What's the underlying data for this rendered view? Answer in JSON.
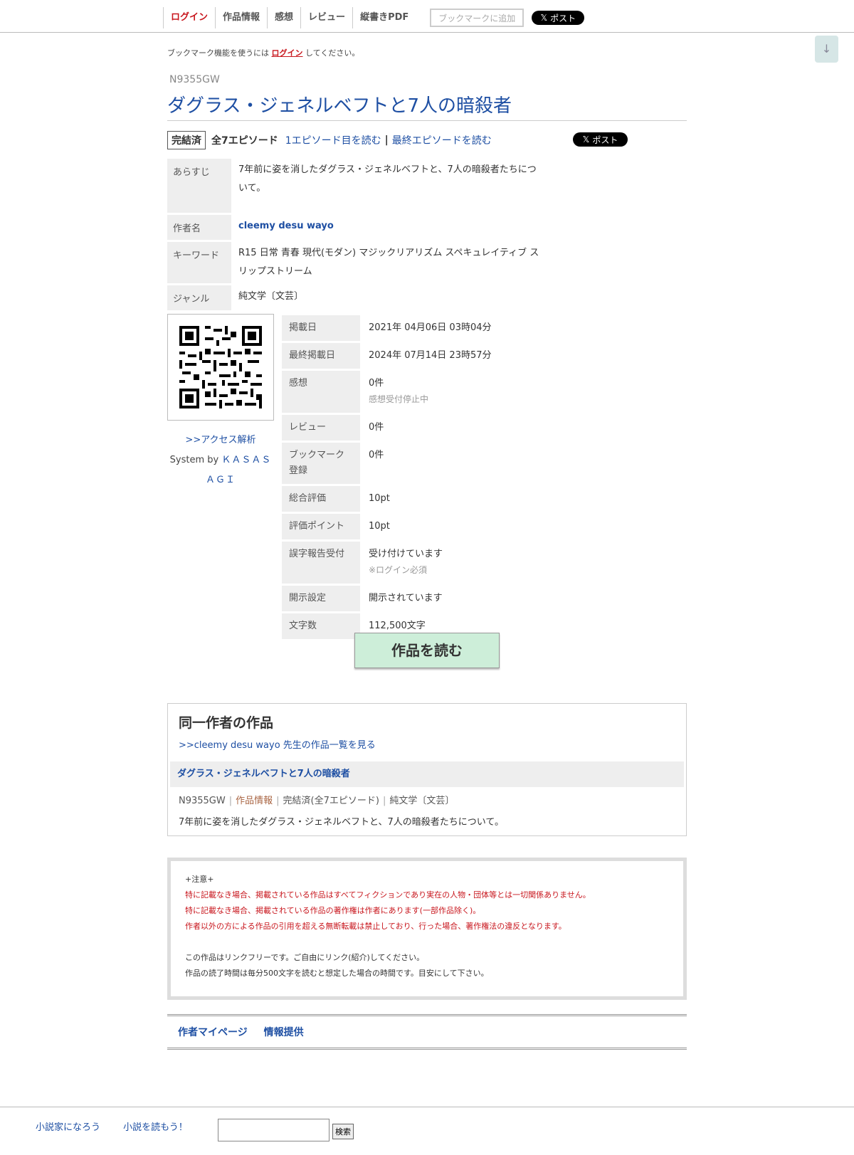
{
  "topnav": {
    "login": "ログイン",
    "novel_info": "作品情報",
    "impressions": "感想",
    "review": "レビュー",
    "pdf": "縦書きPDF",
    "bookmark_add": "ブックマークに追加",
    "x_post": "ポスト"
  },
  "bookmark_note": {
    "prefix": "ブックマーク機能を使うには",
    "login": "ログイン",
    "suffix": "してください。"
  },
  "novel": {
    "ncode": "N9355GW",
    "title": "ダグラス・ジェネルベフトと7人の暗殺者",
    "status": "完結済",
    "episodes": "全7エピソード",
    "read_first": "1エピソード目を読む",
    "separator": "|",
    "read_last": "最終エピソードを読む"
  },
  "info1": [
    {
      "label": "あらすじ",
      "value": "7年前に姿を消したダグラス・ジェネルベフトと、7人の暗殺者たちについて。"
    },
    {
      "label": "作者名",
      "value": "cleemy desu wayo"
    },
    {
      "label": "キーワード",
      "value": "R15 日常 青春 現代(モダン) マジックリアリズム スペキュレイティブ スリップストリーム"
    },
    {
      "label": "ジャンル",
      "value": "純文学〔文芸〕"
    }
  ],
  "access": {
    "link": ">>アクセス解析",
    "system_by": "System by",
    "system_name": "ＫＡＳＡＳＡＧＩ"
  },
  "info2": [
    {
      "label": "掲載日",
      "value": "2021年 04月06日 03時04分",
      "sub": ""
    },
    {
      "label": "最終掲載日",
      "value": "2024年 07月14日 23時57分",
      "sub": ""
    },
    {
      "label": "感想",
      "value": "0件",
      "sub": "感想受付停止中"
    },
    {
      "label": "レビュー",
      "value": "0件",
      "sub": ""
    },
    {
      "label": "ブックマーク登録",
      "value": "0件",
      "sub": ""
    },
    {
      "label": "総合評価",
      "value": "10pt",
      "sub": ""
    },
    {
      "label": "評価ポイント",
      "value": "10pt",
      "sub": ""
    },
    {
      "label": "誤字報告受付",
      "value": "受け付けています",
      "sub": "※ログイン必須"
    },
    {
      "label": "開示設定",
      "value": "開示されています",
      "sub": ""
    },
    {
      "label": "文字数",
      "value": "112,500文字",
      "sub": ""
    }
  ],
  "read_button": "作品を読む",
  "same_author": {
    "heading": "同一作者の作品",
    "list_link": ">>cleemy desu wayo 先生の作品一覧を見る",
    "item": {
      "title": "ダグラス・ジェネルベフトと7人の暗殺者",
      "ncode": "N9355GW",
      "info_link": "作品情報",
      "status": "完結済(全7エピソード)",
      "genre": "純文学〔文芸〕",
      "summary": "7年前に姿を消したダグラス・ジェネルベフトと、7人の暗殺者たちについて。"
    }
  },
  "notice": {
    "heading": "+注意+",
    "line1": "特に記載なき場合、掲載されている作品はすべてフィクションであり実在の人物・団体等とは一切関係ありません。",
    "line2": "特に記載なき場合、掲載されている作品の著作権は作者にあります(一部作品除く)。",
    "line3": "作者以外の方による作品の引用を超える無断転載は禁止しており、行った場合、著作権法の違反となります。",
    "line4": "この作品はリンクフリーです。ご自由にリンク(紹介)してください。",
    "line5": "作品の読了時間は毎分500文字を読むと想定した場合の時間です。目安にして下さい。"
  },
  "bottom_links": {
    "mypage": "作者マイページ",
    "report": "情報提供"
  },
  "footer": {
    "site1": "小説家になろう",
    "site2": "小説を読もう！",
    "search_value": "",
    "search_button": "検索"
  },
  "colors": {
    "link_blue": "#1e4fa3",
    "login_red": "#c8161d",
    "read_button_bg": "#cdeed9",
    "label_bg": "#eeeeee"
  }
}
